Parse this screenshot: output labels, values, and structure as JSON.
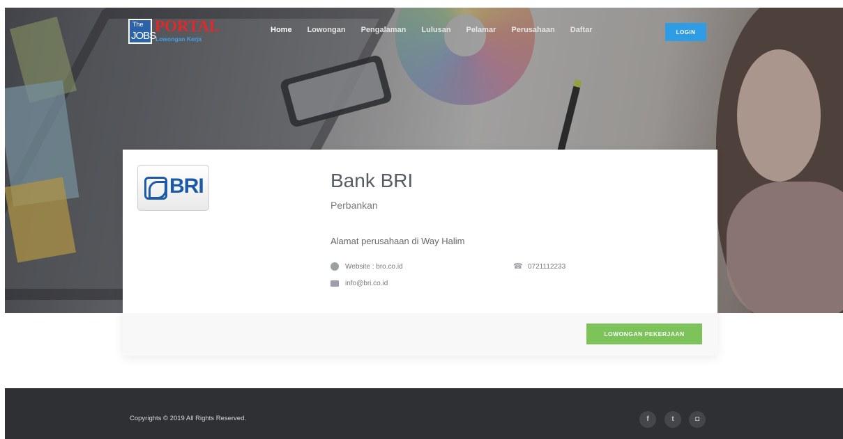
{
  "header": {
    "logo": {
      "the": "The",
      "jobs": "JOBS",
      "portal": "PORTAL",
      "subtitle": "Lowongan Kerja"
    },
    "nav": [
      "Home",
      "Lowongan",
      "Pengalaman",
      "Lulusan",
      "Pelamar",
      "Perusahaan",
      "Daftar"
    ],
    "active_nav": "Home",
    "login_label": "LOGIN"
  },
  "company": {
    "logo_text": "BRI",
    "name": "Bank BRI",
    "sector": "Perbankan",
    "address": "Alamat perusahaan di Way Halim",
    "website": "Website : bro.co.id",
    "phone": "0721112233",
    "email": "info@bri.co.id",
    "jobs_button_label": "LOWONGAN PEKERJAAN"
  },
  "footer": {
    "copyright": "Copyrights © 2019 All Rights Reserved.",
    "social": [
      "facebook-icon",
      "twitter-icon",
      "instagram-icon"
    ]
  },
  "colors": {
    "primary": "#2f9de6",
    "success": "#7cc35a",
    "footer": "#2f3033",
    "brand_red": "#e02a2a"
  }
}
